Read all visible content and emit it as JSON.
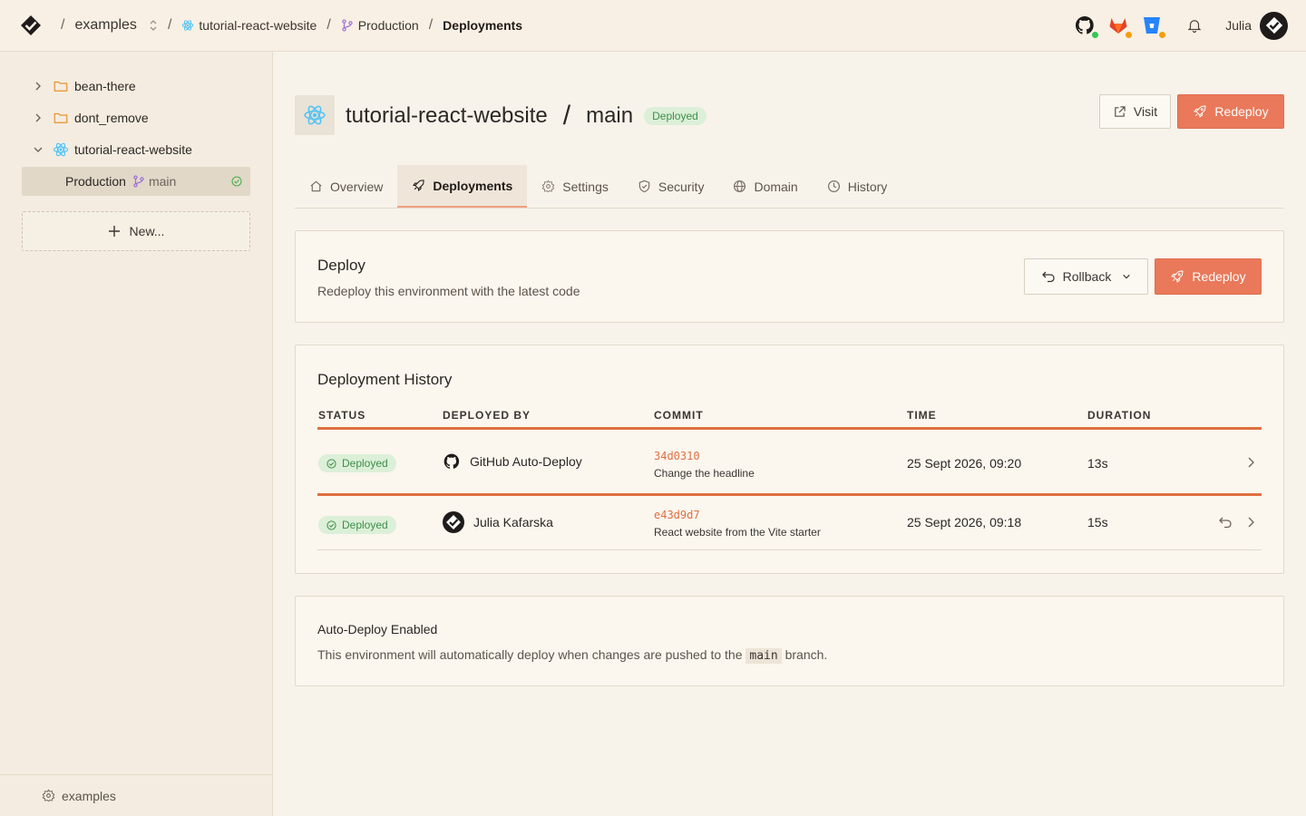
{
  "breadcrumbs": {
    "workspace": "examples",
    "project": "tutorial-react-website",
    "environment": "Production",
    "page": "Deployments"
  },
  "user": {
    "name": "Julia"
  },
  "sidebar": {
    "items": [
      {
        "label": "bean-there"
      },
      {
        "label": "dont_remove"
      },
      {
        "label": "tutorial-react-website"
      }
    ],
    "selected": {
      "label": "Production",
      "branch": "main"
    },
    "new_label": "New...",
    "footer_label": "examples"
  },
  "project": {
    "name": "tutorial-react-website",
    "branch": "main",
    "status": "Deployed",
    "visit_label": "Visit",
    "redeploy_label": "Redeploy"
  },
  "tabs": [
    {
      "label": "Overview"
    },
    {
      "label": "Deployments"
    },
    {
      "label": "Settings"
    },
    {
      "label": "Security"
    },
    {
      "label": "Domain"
    },
    {
      "label": "History"
    }
  ],
  "deploy_card": {
    "title": "Deploy",
    "description": "Redeploy this environment with the latest code",
    "rollback_label": "Rollback",
    "redeploy_label": "Redeploy"
  },
  "history": {
    "title": "Deployment History",
    "columns": [
      "STATUS",
      "DEPLOYED BY",
      "COMMIT",
      "TIME",
      "DURATION"
    ],
    "rows": [
      {
        "status": "Deployed",
        "deployed_by": "GitHub Auto-Deploy",
        "commit_hash": "34d0310",
        "commit_msg": "Change the headline",
        "time": "25 Sept 2026, 09:20",
        "duration": "13s"
      },
      {
        "status": "Deployed",
        "deployed_by": "Julia Kafarska",
        "commit_hash": "e43d9d7",
        "commit_msg": "React website from the Vite starter",
        "time": "25 Sept 2026, 09:18",
        "duration": "15s"
      }
    ]
  },
  "auto_deploy": {
    "title": "Auto-Deploy Enabled",
    "text_before": "This environment will automatically deploy when changes are pushed to the",
    "branch": "main",
    "text_after": "branch."
  },
  "colors": {
    "accent": "#e9795a",
    "success": "#3f8f4a",
    "react": "#4fc3f7"
  }
}
